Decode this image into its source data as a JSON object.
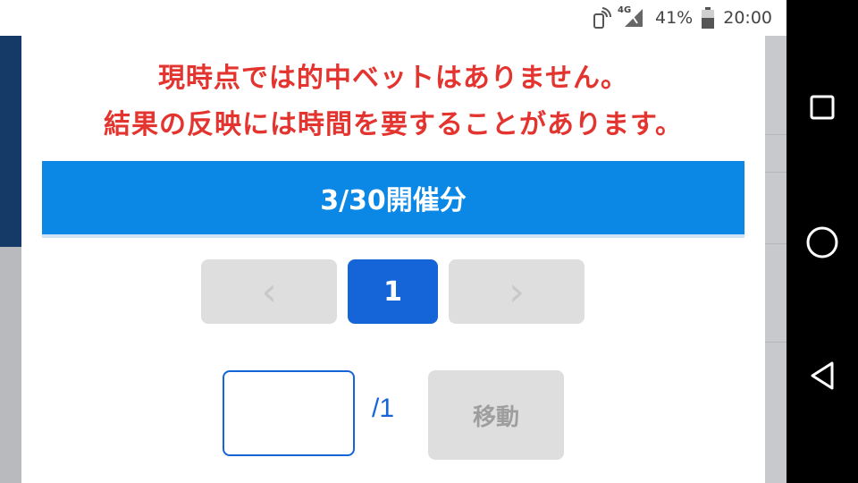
{
  "status_bar": {
    "network": "4G",
    "battery": "41%",
    "time": "20:00"
  },
  "modal": {
    "message_line1": "現時点では的中ベットはありません。",
    "message_line2": "結果の反映には時間を要することがあります。",
    "date_header": "3/30開催分",
    "pager": {
      "prev_glyph": "‹",
      "current_page": "1",
      "next_glyph": "›"
    },
    "page_input_value": "",
    "page_total": "/1",
    "move_label": "移動"
  },
  "colors": {
    "message": "#e3342f",
    "header_bar": "#0b87e6",
    "accent": "#1565d8",
    "disabled": "#dedede"
  }
}
